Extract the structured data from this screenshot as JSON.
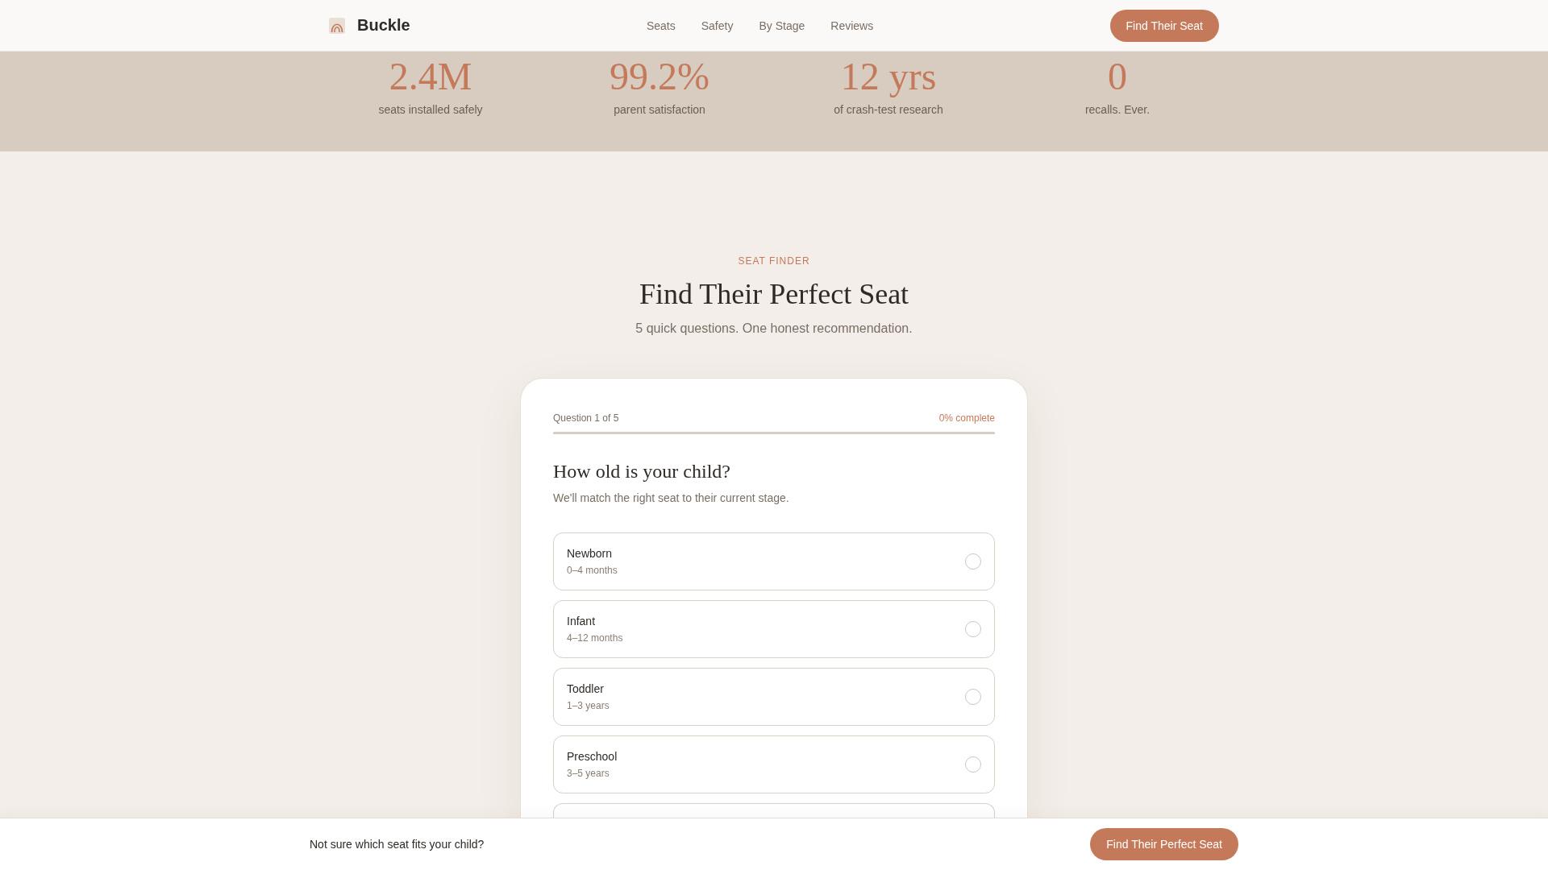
{
  "header": {
    "brand": "Buckle",
    "nav": [
      "Seats",
      "Safety",
      "By Stage",
      "Reviews"
    ],
    "cta": "Find Their Seat"
  },
  "stats": [
    {
      "value": "2.4M",
      "label": "seats installed safely"
    },
    {
      "value": "99.2%",
      "label": "parent satisfaction"
    },
    {
      "value": "12 yrs",
      "label": "of crash-test research"
    },
    {
      "value": "0",
      "label": "recalls. Ever."
    }
  ],
  "seat_finder": {
    "eyebrow": "SEAT FINDER",
    "title": "Find Their Perfect Seat",
    "subtitle": "5 quick questions. One honest recommendation.",
    "quiz": {
      "step": "Question 1 of 5",
      "progress_text": "0% complete",
      "progress": {
        "level": 0
      },
      "question": "How old is your child?",
      "hint": "We'll match the right seat to their current stage.",
      "options": [
        {
          "label": "Newborn",
          "detail": "0–4 months",
          "selected": false
        },
        {
          "label": "Infant",
          "detail": "4–12 months",
          "selected": false
        },
        {
          "label": "Toddler",
          "detail": "1–3 years",
          "selected": false
        },
        {
          "label": "Preschool",
          "detail": "3–5 years",
          "selected": false
        }
      ],
      "more_options_below": true
    }
  },
  "bottom_bar": {
    "text": "Not sure which seat fits your child?",
    "button": "Find Their Perfect Seat"
  }
}
